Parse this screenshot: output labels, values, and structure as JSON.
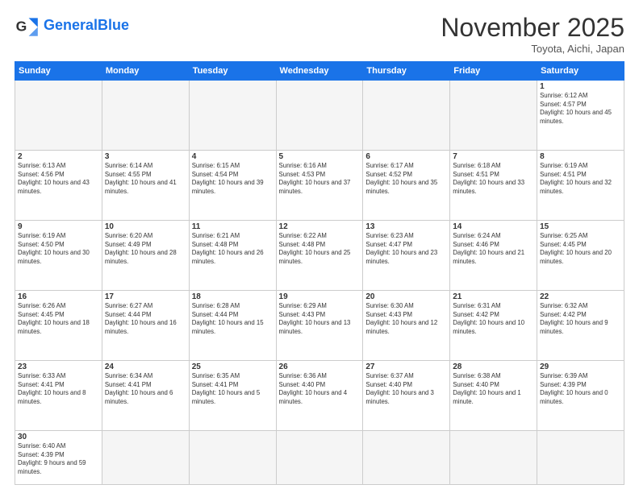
{
  "header": {
    "logo_general": "General",
    "logo_blue": "Blue",
    "month_title": "November 2025",
    "location": "Toyota, Aichi, Japan"
  },
  "days_of_week": [
    "Sunday",
    "Monday",
    "Tuesday",
    "Wednesday",
    "Thursday",
    "Friday",
    "Saturday"
  ],
  "rows": [
    {
      "cells": [
        {
          "day": "",
          "empty": true
        },
        {
          "day": "",
          "empty": true
        },
        {
          "day": "",
          "empty": true
        },
        {
          "day": "",
          "empty": true
        },
        {
          "day": "",
          "empty": true
        },
        {
          "day": "",
          "empty": true
        },
        {
          "day": "1",
          "sunrise": "6:12 AM",
          "sunset": "4:57 PM",
          "daylight": "10 hours and 45 minutes."
        }
      ]
    },
    {
      "cells": [
        {
          "day": "2",
          "sunrise": "6:13 AM",
          "sunset": "4:56 PM",
          "daylight": "10 hours and 43 minutes."
        },
        {
          "day": "3",
          "sunrise": "6:14 AM",
          "sunset": "4:55 PM",
          "daylight": "10 hours and 41 minutes."
        },
        {
          "day": "4",
          "sunrise": "6:15 AM",
          "sunset": "4:54 PM",
          "daylight": "10 hours and 39 minutes."
        },
        {
          "day": "5",
          "sunrise": "6:16 AM",
          "sunset": "4:53 PM",
          "daylight": "10 hours and 37 minutes."
        },
        {
          "day": "6",
          "sunrise": "6:17 AM",
          "sunset": "4:52 PM",
          "daylight": "10 hours and 35 minutes."
        },
        {
          "day": "7",
          "sunrise": "6:18 AM",
          "sunset": "4:51 PM",
          "daylight": "10 hours and 33 minutes."
        },
        {
          "day": "8",
          "sunrise": "6:19 AM",
          "sunset": "4:51 PM",
          "daylight": "10 hours and 32 minutes."
        }
      ]
    },
    {
      "cells": [
        {
          "day": "9",
          "sunrise": "6:19 AM",
          "sunset": "4:50 PM",
          "daylight": "10 hours and 30 minutes."
        },
        {
          "day": "10",
          "sunrise": "6:20 AM",
          "sunset": "4:49 PM",
          "daylight": "10 hours and 28 minutes."
        },
        {
          "day": "11",
          "sunrise": "6:21 AM",
          "sunset": "4:48 PM",
          "daylight": "10 hours and 26 minutes."
        },
        {
          "day": "12",
          "sunrise": "6:22 AM",
          "sunset": "4:48 PM",
          "daylight": "10 hours and 25 minutes."
        },
        {
          "day": "13",
          "sunrise": "6:23 AM",
          "sunset": "4:47 PM",
          "daylight": "10 hours and 23 minutes."
        },
        {
          "day": "14",
          "sunrise": "6:24 AM",
          "sunset": "4:46 PM",
          "daylight": "10 hours and 21 minutes."
        },
        {
          "day": "15",
          "sunrise": "6:25 AM",
          "sunset": "4:45 PM",
          "daylight": "10 hours and 20 minutes."
        }
      ]
    },
    {
      "cells": [
        {
          "day": "16",
          "sunrise": "6:26 AM",
          "sunset": "4:45 PM",
          "daylight": "10 hours and 18 minutes."
        },
        {
          "day": "17",
          "sunrise": "6:27 AM",
          "sunset": "4:44 PM",
          "daylight": "10 hours and 16 minutes."
        },
        {
          "day": "18",
          "sunrise": "6:28 AM",
          "sunset": "4:44 PM",
          "daylight": "10 hours and 15 minutes."
        },
        {
          "day": "19",
          "sunrise": "6:29 AM",
          "sunset": "4:43 PM",
          "daylight": "10 hours and 13 minutes."
        },
        {
          "day": "20",
          "sunrise": "6:30 AM",
          "sunset": "4:43 PM",
          "daylight": "10 hours and 12 minutes."
        },
        {
          "day": "21",
          "sunrise": "6:31 AM",
          "sunset": "4:42 PM",
          "daylight": "10 hours and 10 minutes."
        },
        {
          "day": "22",
          "sunrise": "6:32 AM",
          "sunset": "4:42 PM",
          "daylight": "10 hours and 9 minutes."
        }
      ]
    },
    {
      "cells": [
        {
          "day": "23",
          "sunrise": "6:33 AM",
          "sunset": "4:41 PM",
          "daylight": "10 hours and 8 minutes."
        },
        {
          "day": "24",
          "sunrise": "6:34 AM",
          "sunset": "4:41 PM",
          "daylight": "10 hours and 6 minutes."
        },
        {
          "day": "25",
          "sunrise": "6:35 AM",
          "sunset": "4:41 PM",
          "daylight": "10 hours and 5 minutes."
        },
        {
          "day": "26",
          "sunrise": "6:36 AM",
          "sunset": "4:40 PM",
          "daylight": "10 hours and 4 minutes."
        },
        {
          "day": "27",
          "sunrise": "6:37 AM",
          "sunset": "4:40 PM",
          "daylight": "10 hours and 3 minutes."
        },
        {
          "day": "28",
          "sunrise": "6:38 AM",
          "sunset": "4:40 PM",
          "daylight": "10 hours and 1 minute."
        },
        {
          "day": "29",
          "sunrise": "6:39 AM",
          "sunset": "4:39 PM",
          "daylight": "10 hours and 0 minutes."
        }
      ]
    },
    {
      "cells": [
        {
          "day": "30",
          "sunrise": "6:40 AM",
          "sunset": "4:39 PM",
          "daylight": "9 hours and 59 minutes."
        },
        {
          "day": "",
          "empty": true
        },
        {
          "day": "",
          "empty": true
        },
        {
          "day": "",
          "empty": true
        },
        {
          "day": "",
          "empty": true
        },
        {
          "day": "",
          "empty": true
        },
        {
          "day": "",
          "empty": true
        }
      ]
    }
  ]
}
